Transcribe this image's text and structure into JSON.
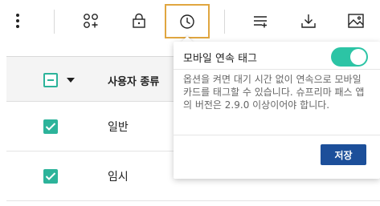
{
  "toolbar": {
    "icons": [
      "more-vertical-icon",
      "add-apps-icon",
      "lock-icon",
      "clock-icon",
      "list-add-icon",
      "download-icon",
      "image-icon"
    ],
    "active_icon": "clock-icon"
  },
  "table": {
    "header": {
      "user_type_label": "사용자 종류"
    },
    "rows": [
      {
        "user_type": "일반",
        "checked": true
      },
      {
        "user_type": "임시",
        "checked": true
      }
    ]
  },
  "popover": {
    "title": "모바일 연속 태그",
    "toggle_on": true,
    "description": "옵션을 켜면 대기 시간 없이 연속으로 모바일 카드를 태그할 수 있습니다. 슈프리마 패스 앱의 버전은 2.9.0 이상이어야 합니다.",
    "save_label": "저장"
  },
  "colors": {
    "accent_teal": "#2cc4a5",
    "checkbox_teal": "#2cb39a",
    "primary_blue": "#1c4f9a",
    "active_border": "#e0a640"
  }
}
